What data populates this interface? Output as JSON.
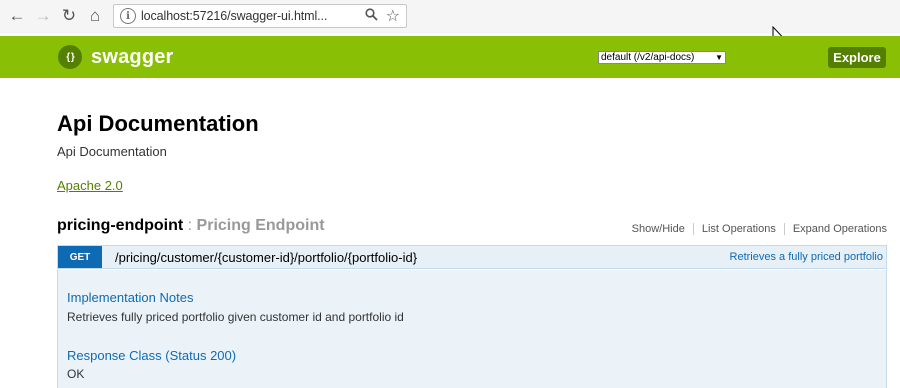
{
  "browser": {
    "back_icon": "←",
    "forward_icon": "→",
    "reload_icon": "↻",
    "home_icon": "⌂",
    "url": "localhost:57216/swagger-ui.html...",
    "zoom_icon": "🔍",
    "star_icon": "☆"
  },
  "header": {
    "logo_glyph": "{ }",
    "logo_text": "swagger",
    "spec_selected": "default (/v2/api-docs)",
    "spec_arrow": "▼",
    "explore_label": "Explore",
    "brand_color": "#89bf04"
  },
  "info": {
    "title": "Api Documentation",
    "description": "Api Documentation",
    "license": "Apache 2.0"
  },
  "resource": {
    "name": "pricing-endpoint",
    "separator": " : ",
    "description": "Pricing Endpoint",
    "actions": [
      "Show/Hide",
      "List Operations",
      "Expand Operations"
    ]
  },
  "operation": {
    "method": "GET",
    "method_color": "#0f6ab4",
    "path": "/pricing/customer/{customer-id}/portfolio/{portfolio-id}",
    "summary": "Retrieves a fully priced portfolio",
    "implementation_notes_title": "Implementation Notes",
    "implementation_notes": "Retrieves fully priced portfolio given customer id and portfolio id",
    "response_class_title": "Response Class (Status 200)",
    "response_class": "OK"
  }
}
